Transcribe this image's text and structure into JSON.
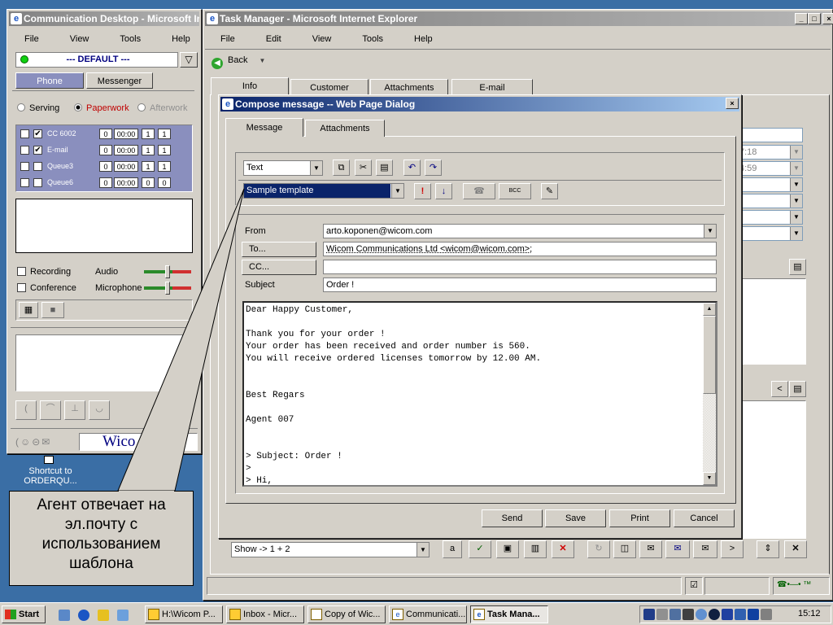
{
  "desktop": {
    "shortcut_label": "Shortcut to ORDERQU..."
  },
  "comm_desktop": {
    "title": "Communication Desktop - Microsoft Internet Explorer",
    "menu": [
      "File",
      "View",
      "Tools",
      "Help"
    ],
    "profile": "--- DEFAULT ---",
    "tabs": [
      "Phone",
      "Messenger"
    ],
    "states": [
      "Serving",
      "Paperwork",
      "Afterwork"
    ],
    "queues": [
      {
        "name": "CC 6002",
        "a": "0",
        "time": "00:00",
        "b": "1",
        "c": "1"
      },
      {
        "name": "E-mail",
        "a": "0",
        "time": "00:00",
        "b": "1",
        "c": "1"
      },
      {
        "name": "Queue3",
        "a": "0",
        "time": "00:00",
        "b": "1",
        "c": "1"
      },
      {
        "name": "Queue6",
        "a": "0",
        "time": "00:00",
        "b": "0",
        "c": "0"
      }
    ],
    "recording": "Recording",
    "conference": "Conference",
    "audio": "Audio",
    "microphone": "Microphone",
    "logo_text": "Wico"
  },
  "callout": {
    "text": "Агент отвечает на эл.почту с использованием шаблона"
  },
  "task_manager": {
    "title": "Task Manager - Microsoft Internet Explorer",
    "menu": [
      "File",
      "Edit",
      "View",
      "Tools",
      "Help"
    ],
    "back": "Back",
    "tabs": [
      "Info",
      "Customer",
      "Attachments",
      "E-mail"
    ],
    "times": [
      "7:18",
      "4:59"
    ],
    "show_select": "Show -> 1 + 2"
  },
  "compose": {
    "title": "Compose message -- Web Page Dialog",
    "tabs": [
      "Message",
      "Attachments"
    ],
    "format": "Text",
    "template": "Sample template",
    "bcc_label": "BCC",
    "from_label": "From",
    "from_value": "arto.koponen@wicom.com",
    "to_label": "To...",
    "to_value": "Wicom Communications Ltd <wicom@wicom.com>;",
    "cc_label": "CC...",
    "cc_value": "",
    "subject_label": "Subject",
    "subject_value": "Order !",
    "body": "Dear Happy Customer,\n\nThank you for your order !\nYour order has been received and order number is 560.\nYou will receive ordered licenses tomorrow by 12.00 AM.\n\n\nBest Regars\n\nAgent 007\n\n\n> Subject: Order !\n>\n> Hi,",
    "buttons": {
      "send": "Send",
      "save": "Save",
      "print": "Print",
      "cancel": "Cancel"
    }
  },
  "taskbar": {
    "start": "Start",
    "tasks": [
      "H:\\Wicom P...",
      "Inbox - Micr...",
      "Copy of Wic...",
      "Communicati...",
      "Task Mana..."
    ],
    "clock": "15:12"
  }
}
